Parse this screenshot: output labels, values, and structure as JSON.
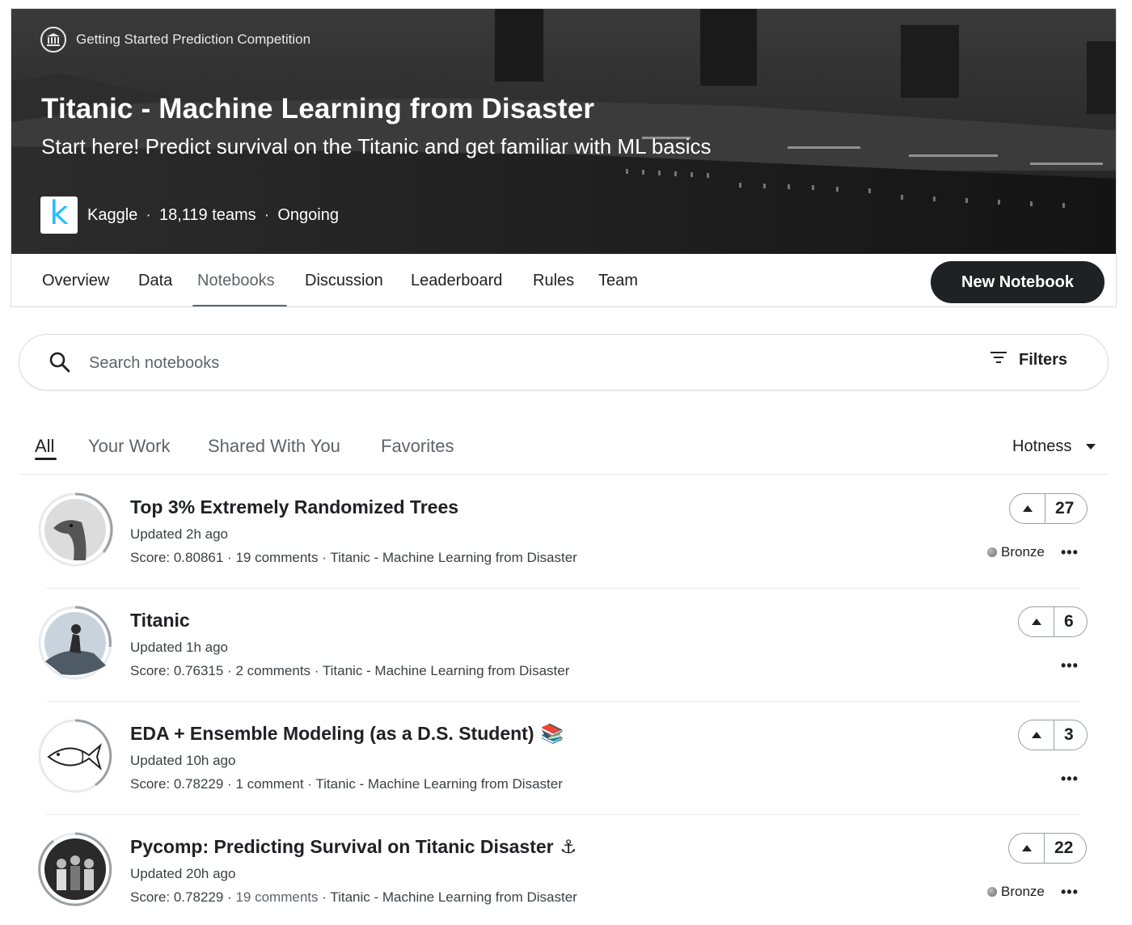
{
  "header": {
    "competition_type": "Getting Started Prediction Competition",
    "title": "Titanic - Machine Learning from Disaster",
    "subtitle": "Start here! Predict survival on the Titanic and get familiar with ML basics",
    "host": "Kaggle",
    "host_logo_letter": "k",
    "teams": "18,119 teams",
    "status": "Ongoing",
    "separator": "·"
  },
  "nav": {
    "tabs": [
      {
        "label": "Overview"
      },
      {
        "label": "Data"
      },
      {
        "label": "Notebooks"
      },
      {
        "label": "Discussion"
      },
      {
        "label": "Leaderboard"
      },
      {
        "label": "Rules"
      },
      {
        "label": "Team"
      }
    ],
    "active_tab": "Notebooks",
    "new_notebook_label": "New Notebook"
  },
  "search": {
    "placeholder": "Search notebooks",
    "value": "",
    "filters_label": "Filters"
  },
  "filter_tabs": [
    {
      "label": "All"
    },
    {
      "label": "Your Work"
    },
    {
      "label": "Shared With You"
    },
    {
      "label": "Favorites"
    }
  ],
  "active_filter_tab": "All",
  "sort": {
    "selected": "Hotness"
  },
  "notebooks": [
    {
      "title": "Top 3% Extremely Randomized Trees",
      "emoji": "",
      "updated": "Updated 2h ago",
      "score": "Score: 0.80861",
      "comments": "19 comments",
      "competition": "Titanic - Machine Learning from Disaster",
      "votes": "27",
      "medal": "Bronze",
      "avatar": "ostrich-avatar"
    },
    {
      "title": "Titanic",
      "emoji": "",
      "updated": "Updated 1h ago",
      "score": "Score: 0.76315",
      "comments": "2 comments",
      "competition": "Titanic - Machine Learning from Disaster",
      "votes": "6",
      "medal": "",
      "avatar": "person-avatar"
    },
    {
      "title": "EDA + Ensemble Modeling (as a D.S. Student)",
      "emoji": "📚",
      "updated": "Updated 10h ago",
      "score": "Score: 0.78229",
      "comments": "1 comment",
      "competition": "Titanic - Machine Learning from Disaster",
      "votes": "3",
      "medal": "",
      "avatar": "fish-avatar"
    },
    {
      "title": "Pycomp: Predicting Survival on Titanic Disaster",
      "emoji": "⚓",
      "updated": "Updated 20h ago",
      "score": "Score: 0.78229",
      "comments": "19 comments",
      "competition": "Titanic - Machine Learning from Disaster",
      "votes": "22",
      "medal": "Bronze",
      "avatar": "group-avatar"
    }
  ],
  "meta_separator": "·",
  "more_label": "•••",
  "colors": {
    "accent_dark": "#202124",
    "kaggle_blue": "#20beff",
    "muted_text": "#5f6368",
    "border": "#dadce0"
  }
}
